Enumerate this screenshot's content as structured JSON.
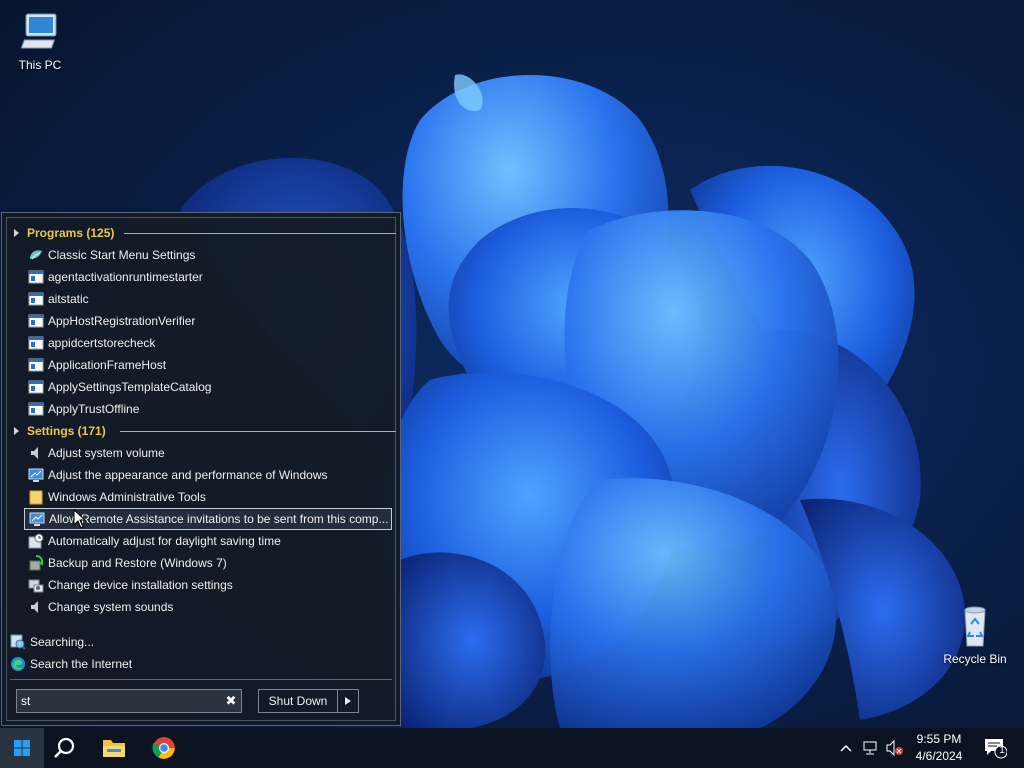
{
  "desktop": {
    "icons": [
      {
        "label": "This PC",
        "icon": "computer-icon"
      },
      {
        "label": "Recycle Bin",
        "icon": "recycle-bin-icon"
      }
    ]
  },
  "start_menu": {
    "programs_header": "Programs (125)",
    "programs": [
      {
        "label": "Classic Start Menu Settings",
        "icon": "shell-icon"
      },
      {
        "label": "agentactivationruntimestarter",
        "icon": "app-window-icon"
      },
      {
        "label": "aitstatic",
        "icon": "app-window-icon"
      },
      {
        "label": "AppHostRegistrationVerifier",
        "icon": "app-window-icon"
      },
      {
        "label": "appidcertstorecheck",
        "icon": "app-window-icon"
      },
      {
        "label": "ApplicationFrameHost",
        "icon": "app-window-icon"
      },
      {
        "label": "ApplySettingsTemplateCatalog",
        "icon": "app-window-icon"
      },
      {
        "label": "ApplyTrustOffline",
        "icon": "app-window-icon"
      }
    ],
    "settings_header": "Settings (171)",
    "settings": [
      {
        "label": "Adjust system volume",
        "icon": "speaker-icon"
      },
      {
        "label": "Adjust the appearance and performance of Windows",
        "icon": "monitor-icon"
      },
      {
        "label": "Windows Administrative Tools",
        "icon": "folder-icon"
      },
      {
        "label": "Allow Remote Assistance invitations to be sent from this comp...",
        "icon": "monitor-icon",
        "selected": true
      },
      {
        "label": "Automatically adjust for daylight saving time",
        "icon": "clock-icon"
      },
      {
        "label": "Backup and Restore (Windows 7)",
        "icon": "backup-icon"
      },
      {
        "label": "Change device installation settings",
        "icon": "device-icon"
      },
      {
        "label": "Change system sounds",
        "icon": "speaker-icon"
      }
    ],
    "searching_label": "Searching...",
    "search_internet_label": "Search the Internet",
    "search_value": "st",
    "shutdown_label": "Shut Down"
  },
  "taskbar": {
    "apps": [
      "start-icon",
      "search-icon",
      "file-explorer-icon",
      "chrome-icon"
    ],
    "clock_time": "9:55 PM",
    "clock_date": "4/6/2024",
    "notification_count": "1"
  },
  "colors": {
    "section_header": "#e8c84a",
    "menu_bg": "#141b26",
    "taskbar_bg": "#0b1320"
  }
}
